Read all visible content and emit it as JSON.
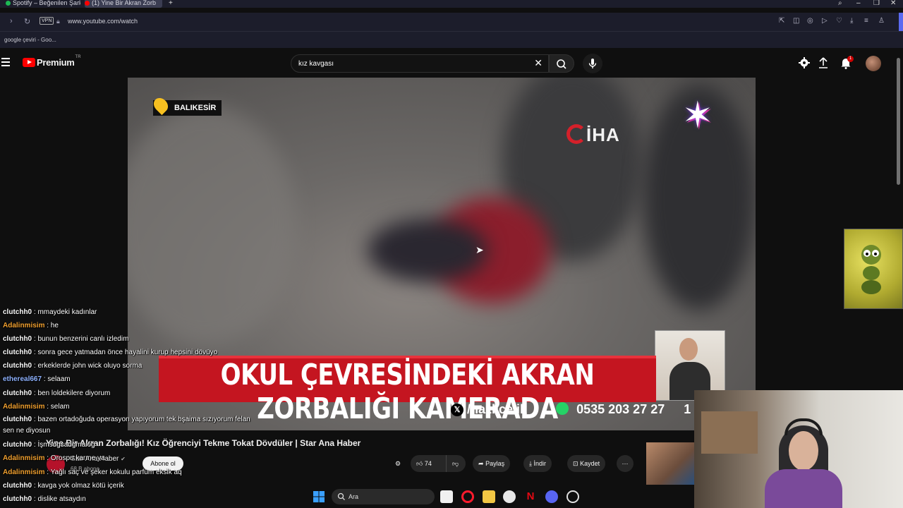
{
  "browser": {
    "tabs": [
      {
        "label": "Spotify – Beğenilen Şarkıl",
        "icon_color": "#1db954"
      },
      {
        "label": "(1) Yine Bir Akran Zorb",
        "icon_color": "#ff0000"
      }
    ],
    "new_tab": "+",
    "url": "www.youtube.com/watch",
    "vpn_label": "VPN",
    "bookmark": "google çeviri - Goo..."
  },
  "youtube": {
    "brand": "Premium",
    "region": "TR",
    "search_query": "kız kavgası",
    "notification_count": "1"
  },
  "video": {
    "location_tag": "BALIKESİR",
    "agency_logo": "İHA",
    "banner": "OKUL ÇEVRESİNDEKİ AKRAN ZORBALIĞI KAMERADA",
    "social_handle": "/nazlicelik_",
    "phone": "0535 203 27 27",
    "clipped_number": "1"
  },
  "meta": {
    "title": "Yine Bir Akran Zorbalığı! Kız Öğrenciyi Tekme Tokat Dövdüler | Star Ana Haber",
    "channel": "Star Ana Haber",
    "subscribers": "68 B abone",
    "subscribe_label": "Abone ol",
    "like_count": "74",
    "share_label": "Paylaş",
    "download_label": "İndir",
    "save_label": "Kaydet"
  },
  "chat": [
    {
      "user": "clutchh0",
      "message": "mmaydeki kadınlar",
      "color": "#ffffff"
    },
    {
      "user": "Adalinmisim",
      "message": "he",
      "color": "#f0a030"
    },
    {
      "user": "clutchh0",
      "message": "bunun benzerini canlı izledim",
      "color": "#ffffff"
    },
    {
      "user": "clutchh0",
      "message": "sonra gece yatmadan önce hayalini kurup hepsini dövüyo",
      "color": "#ffffff"
    },
    {
      "user": "clutchh0",
      "message": "erkeklerde john wick oluyo sorma",
      "color": "#ffffff"
    },
    {
      "user": "ethereal667",
      "message": "selaam",
      "color": "#8fb3ff"
    },
    {
      "user": "clutchh0",
      "message": "ben loldekilere diyorum",
      "color": "#ffffff"
    },
    {
      "user": "Adalinmisim",
      "message": "selam",
      "color": "#f0a030"
    },
    {
      "user": "clutchh0",
      "message": "bazen ortadoğuda operasyon yapıyorum tek bşaima sızıyorum felan sen ne diyosun",
      "color": "#ffffff"
    },
    {
      "user": "clutchh0",
      "message": "İşmsdgsadgmalög",
      "color": "#ffffff"
    },
    {
      "user": "Adalinmisim",
      "message": "Orospu karıne ya",
      "color": "#f0a030"
    },
    {
      "user": "Adalinmisim",
      "message": "Yağlı saç ve şeker kokulu parfüm eksik aq",
      "color": "#f0a030"
    },
    {
      "user": "clutchh0",
      "message": "kavga yok olmaz kötü içerik",
      "color": "#ffffff"
    },
    {
      "user": "clutchh0",
      "message": "dislike atsaydın",
      "color": "#ffffff"
    }
  ],
  "taskbar": {
    "search_placeholder": "Ara"
  }
}
